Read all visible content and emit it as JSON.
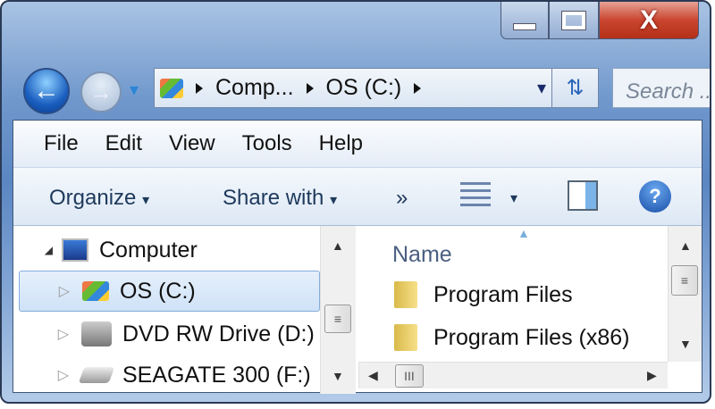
{
  "window": {
    "minimize": "—",
    "maximize": "□",
    "close": "X"
  },
  "nav_buttons": {
    "back": "←",
    "forward": "→",
    "recent": "▾"
  },
  "address": {
    "crumbs": [
      "Comp...",
      "OS (C:)"
    ],
    "dropdown": "▾",
    "refresh": "⇅"
  },
  "search": {
    "placeholder": "Search ..."
  },
  "menu": [
    "File",
    "Edit",
    "View",
    "Tools",
    "Help"
  ],
  "toolbar": {
    "organize": "Organize",
    "share": "Share with",
    "more": "»",
    "caret": "▾",
    "help": "?"
  },
  "tree": [
    {
      "label": "Computer",
      "expander": "◢"
    },
    {
      "label": "OS (C:)",
      "expander": "▷"
    },
    {
      "label": "DVD RW Drive (D:)",
      "expander": "▷"
    },
    {
      "label": "SEAGATE 300 (F:)",
      "expander": "▷"
    }
  ],
  "files": {
    "column": "Name",
    "sort": "▲",
    "items": [
      "Program Files",
      "Program Files (x86)"
    ]
  },
  "scroll": {
    "up": "▲",
    "down": "▼",
    "left": "◀",
    "right": "▶",
    "grip": "≡",
    "hgrip": "III"
  }
}
